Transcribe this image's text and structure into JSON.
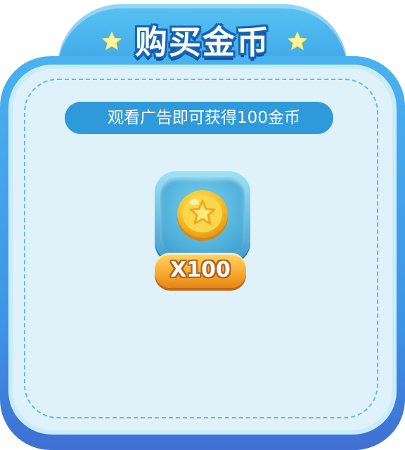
{
  "dialog": {
    "title": "购买金币",
    "info_text": "观看广告即可获得100金币"
  },
  "reward": {
    "icon": "star-coin-icon",
    "quantity_label": "X100"
  },
  "decor": {
    "left_star": "star-icon",
    "right_star": "star-icon"
  },
  "colors": {
    "panel_blue": "#3d93e6",
    "panel_fill": "#dff1f9",
    "pill_blue": "#2f9ad9",
    "badge_orange": "#f6a528",
    "coin_gold": "#f7c52d"
  }
}
